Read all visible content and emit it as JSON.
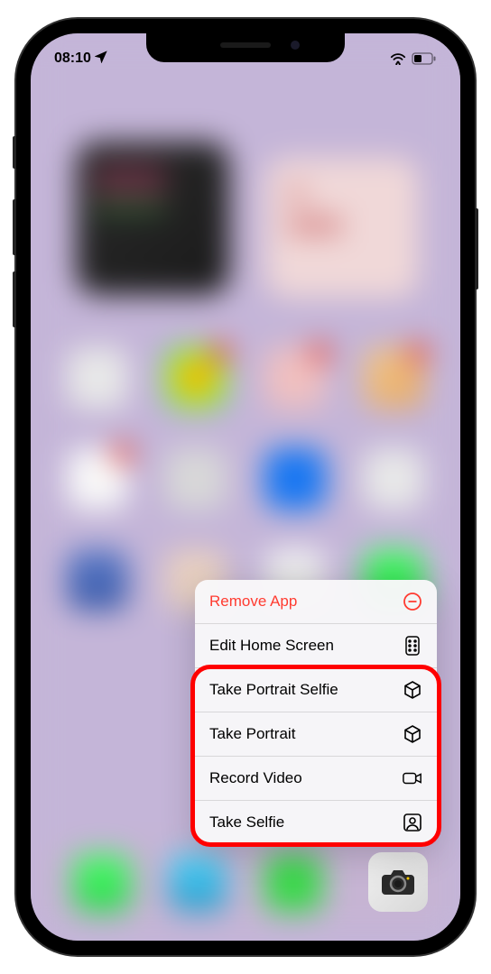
{
  "status_bar": {
    "time": "08:10",
    "location_active": true
  },
  "context_menu": {
    "items": [
      {
        "label": "Remove App",
        "icon": "remove-circle",
        "destructive": true
      },
      {
        "label": "Edit Home Screen",
        "icon": "apps-grid",
        "destructive": false
      },
      {
        "label": "Take Portrait Selfie",
        "icon": "cube",
        "destructive": false
      },
      {
        "label": "Take Portrait",
        "icon": "cube",
        "destructive": false
      },
      {
        "label": "Record Video",
        "icon": "video-camera",
        "destructive": false
      },
      {
        "label": "Take Selfie",
        "icon": "person-square",
        "destructive": false
      }
    ]
  },
  "highlighted_app": "Camera"
}
